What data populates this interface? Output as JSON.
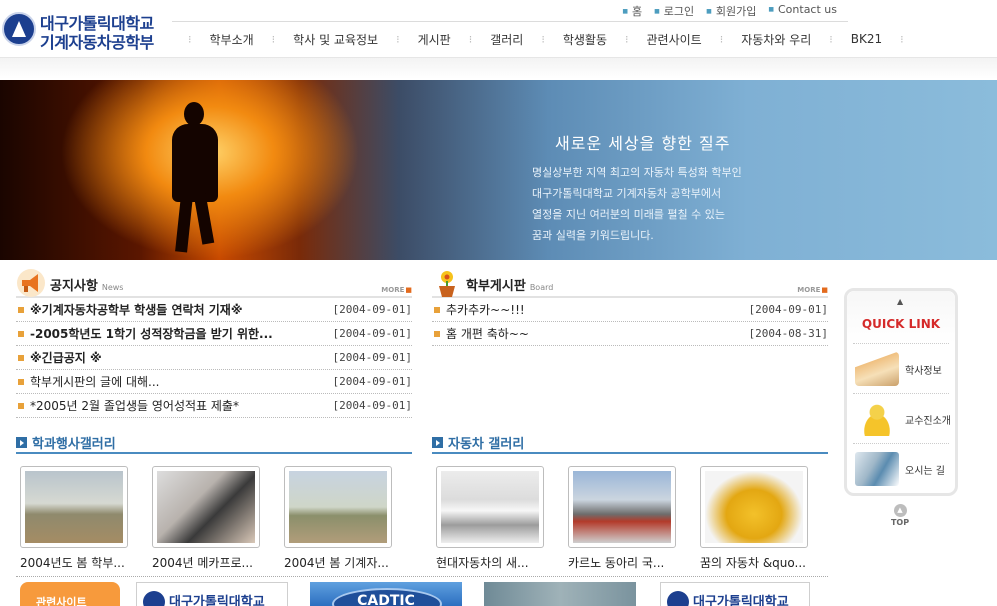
{
  "logo": {
    "line1": "대구가톨릭대학교",
    "line2": "기계자동차공학부"
  },
  "top_nav": {
    "links": [
      "홈",
      "로그인",
      "회원가입",
      "Contact us"
    ]
  },
  "gnb": {
    "items": [
      "학부소개",
      "학사 및 교육정보",
      "게시판",
      "갤러리",
      "학생활동",
      "관련사이트",
      "자동차와 우리",
      "BK21"
    ]
  },
  "hero": {
    "title": "새로운 세상을 향한 질주",
    "lines": [
      "명실상부한 지역 최고의 자동차 특성화 학부인",
      "대구가톨릭대학교 기계자동차 공학부에서",
      "열정을 지닌 여러분의 미래를 펼칠 수 있는",
      "꿈과 실력을 키워드립니다."
    ]
  },
  "notice": {
    "title": "공지사항",
    "subtitle": "News",
    "more": "MORE",
    "items": [
      {
        "title": "※기계자동차공학부 학생들 연락처 기재※",
        "date": "[2004-09-01]"
      },
      {
        "title": "-2005학년도 1학기 성적장학금을 받기 위한...",
        "date": "[2004-09-01]"
      },
      {
        "title": "※긴급공지 ※",
        "date": "[2004-09-01]"
      },
      {
        "title": "학부게시판의 글에 대해...",
        "date": "[2004-09-01]"
      },
      {
        "title": "*2005년 2월 졸업생들 영어성적표 제출*",
        "date": "[2004-09-01]"
      }
    ]
  },
  "board": {
    "title": "학부게시판",
    "subtitle": "Board",
    "more": "MORE",
    "items": [
      {
        "title": "추카추카~~!!!",
        "date": "[2004-09-01]"
      },
      {
        "title": "홈 개편 축하~~",
        "date": "[2004-08-31]"
      }
    ]
  },
  "dept_gallery": {
    "title": "학과행사갤러리",
    "items": [
      {
        "caption": "2004년도 봄 학부..."
      },
      {
        "caption": "2004년 메카프로..."
      },
      {
        "caption": "2004년 봄 기계자..."
      }
    ]
  },
  "car_gallery": {
    "title": "자동차 갤러리",
    "items": [
      {
        "caption": "현대자동차의 새..."
      },
      {
        "caption": "카르노 동아리 국..."
      },
      {
        "caption": "꿈의 자동차 &quo..."
      }
    ]
  },
  "quick_link": {
    "arrow": "▲",
    "title": "QUICK LINK",
    "items": [
      {
        "label": "학사정보",
        "icon": "book-icon"
      },
      {
        "label": "교수진소개",
        "icon": "professor-icon"
      },
      {
        "label": "오시는 길",
        "icon": "map-icon"
      }
    ]
  },
  "top_button": {
    "arrow": "▲",
    "label": "TOP"
  },
  "banners": {
    "related": "관련사이트",
    "univ1": "대구가톨릭대학교",
    "cadtic": "CADTIC",
    "univ2": "대구가톨릭대학교"
  }
}
